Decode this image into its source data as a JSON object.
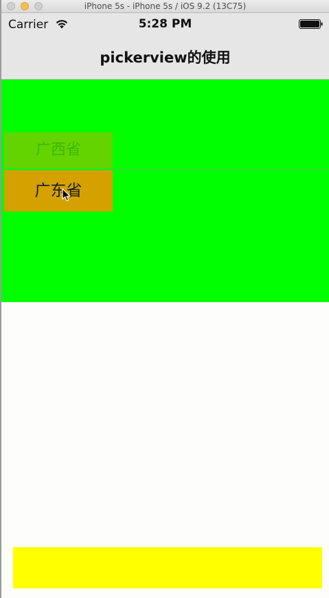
{
  "window": {
    "title": "iPhone 5s - iPhone 5s / iOS 9.2 (13C75)"
  },
  "status_bar": {
    "carrier": "Carrier",
    "time": "5:28 PM",
    "icons": [
      "wifi-icon",
      "battery-icon"
    ]
  },
  "nav": {
    "title": "pickerview的使用"
  },
  "picker": {
    "rows": [
      {
        "label": "广西省",
        "state": "above-selection"
      },
      {
        "label": "广东省",
        "state": "selected"
      }
    ],
    "colors": {
      "background": "#00ff00",
      "row_above_bg": "#63d400",
      "row_selected_bg": "#d5a100"
    }
  },
  "bottom_bar": {
    "color": "#ffff00"
  }
}
